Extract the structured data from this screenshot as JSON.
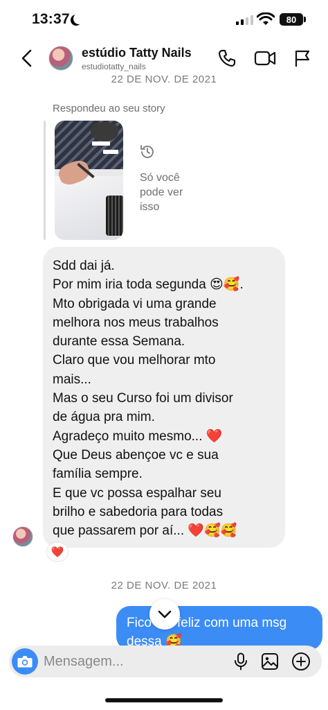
{
  "status_bar": {
    "time": "13:37",
    "battery": "80"
  },
  "header": {
    "name": "estúdio Tatty Nails",
    "handle": "estudiotatty_nails"
  },
  "dates": {
    "top": "22 DE NOV. DE 2021",
    "bottom": "22 DE NOV. DE 2021"
  },
  "story_reply": {
    "label": "Respondeu ao seu story",
    "note": "Só você pode ver isso"
  },
  "incoming_message": {
    "lines": [
      "Sdd dai já.",
      "Por mim iria toda segunda 😍🥰.",
      "Mto obrigada vi uma grande",
      "melhora nos meus trabalhos",
      "durante essa Semana.",
      "Claro que vou melhorar mto",
      "mais...",
      "Mas o seu Curso foi um divisor",
      "de água pra mim.",
      "Agradeço muito mesmo... ❤️",
      "Que Deus abençoe vc e sua",
      "família sempre.",
      "E que vc possa espalhar seu",
      "brilho e sabedoria para todas",
      "que passarem por aí... ❤️🥰🥰"
    ],
    "reaction": "❤️"
  },
  "outgoing_message": {
    "lines": [
      "Fico tão feliz com uma msg",
      "dessa 🥰"
    ]
  },
  "composer": {
    "placeholder": "Mensagem..."
  },
  "colors": {
    "accent": "#3c8cf6",
    "incoming_bubble": "#efefef"
  },
  "icons": [
    "back-icon",
    "call-icon",
    "video-icon",
    "flag-icon",
    "history-icon",
    "chevron-down-icon",
    "camera-icon",
    "mic-icon",
    "gallery-icon",
    "plus-icon"
  ]
}
